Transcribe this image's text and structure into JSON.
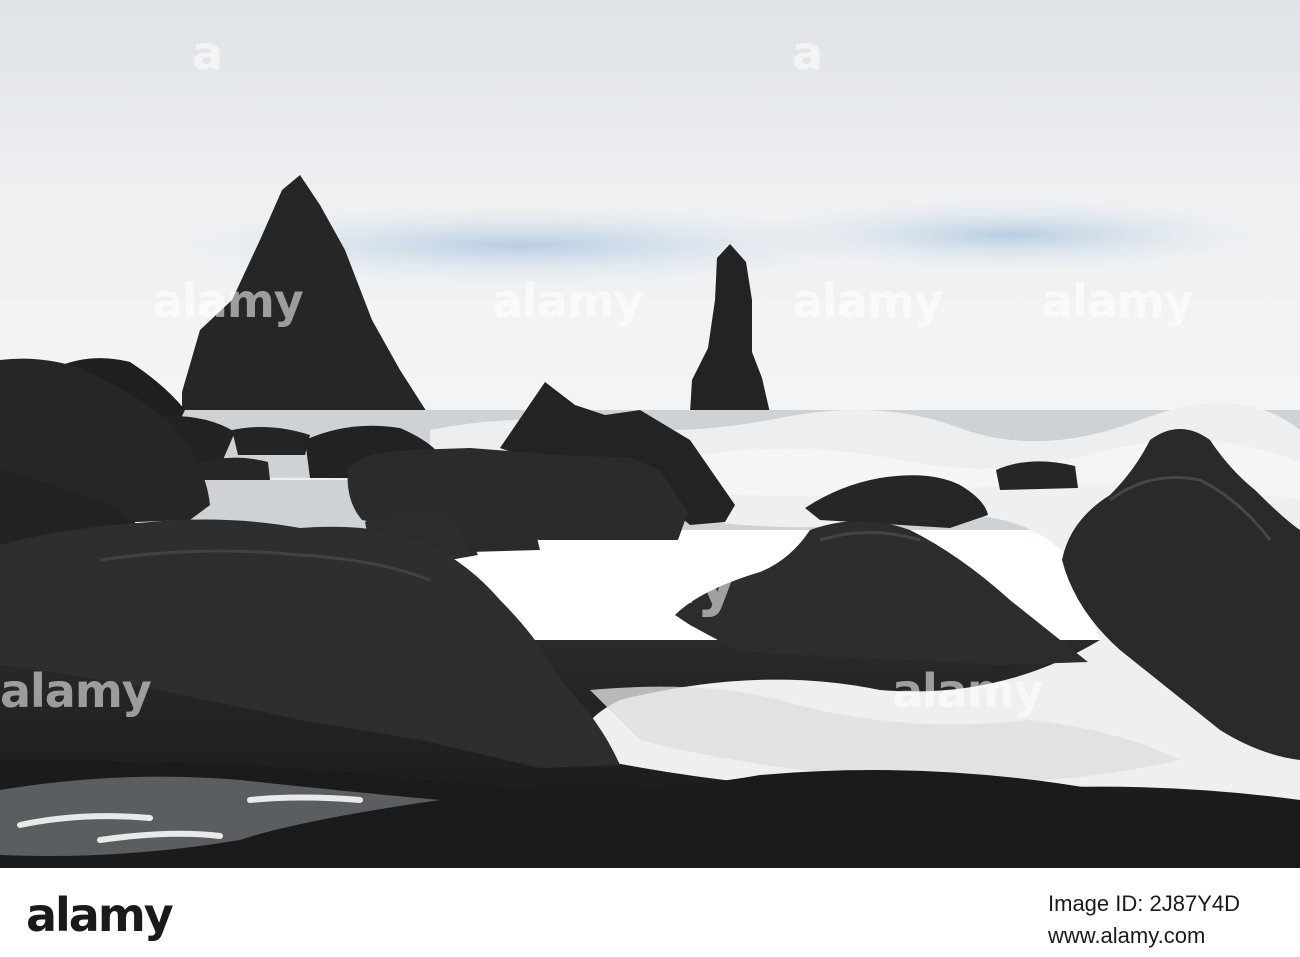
{
  "photo": {
    "watermark_text": "alamy",
    "colors": {
      "sky": "#e9ecef",
      "sky_blue": "#b9cfe2",
      "rock": "#1c1c1c",
      "sand": "#222222",
      "foam": "#f2f2f2"
    }
  },
  "footer": {
    "logo": "alamy",
    "image_id": "Image ID: 2J87Y4D",
    "url": "www.alamy.com"
  }
}
